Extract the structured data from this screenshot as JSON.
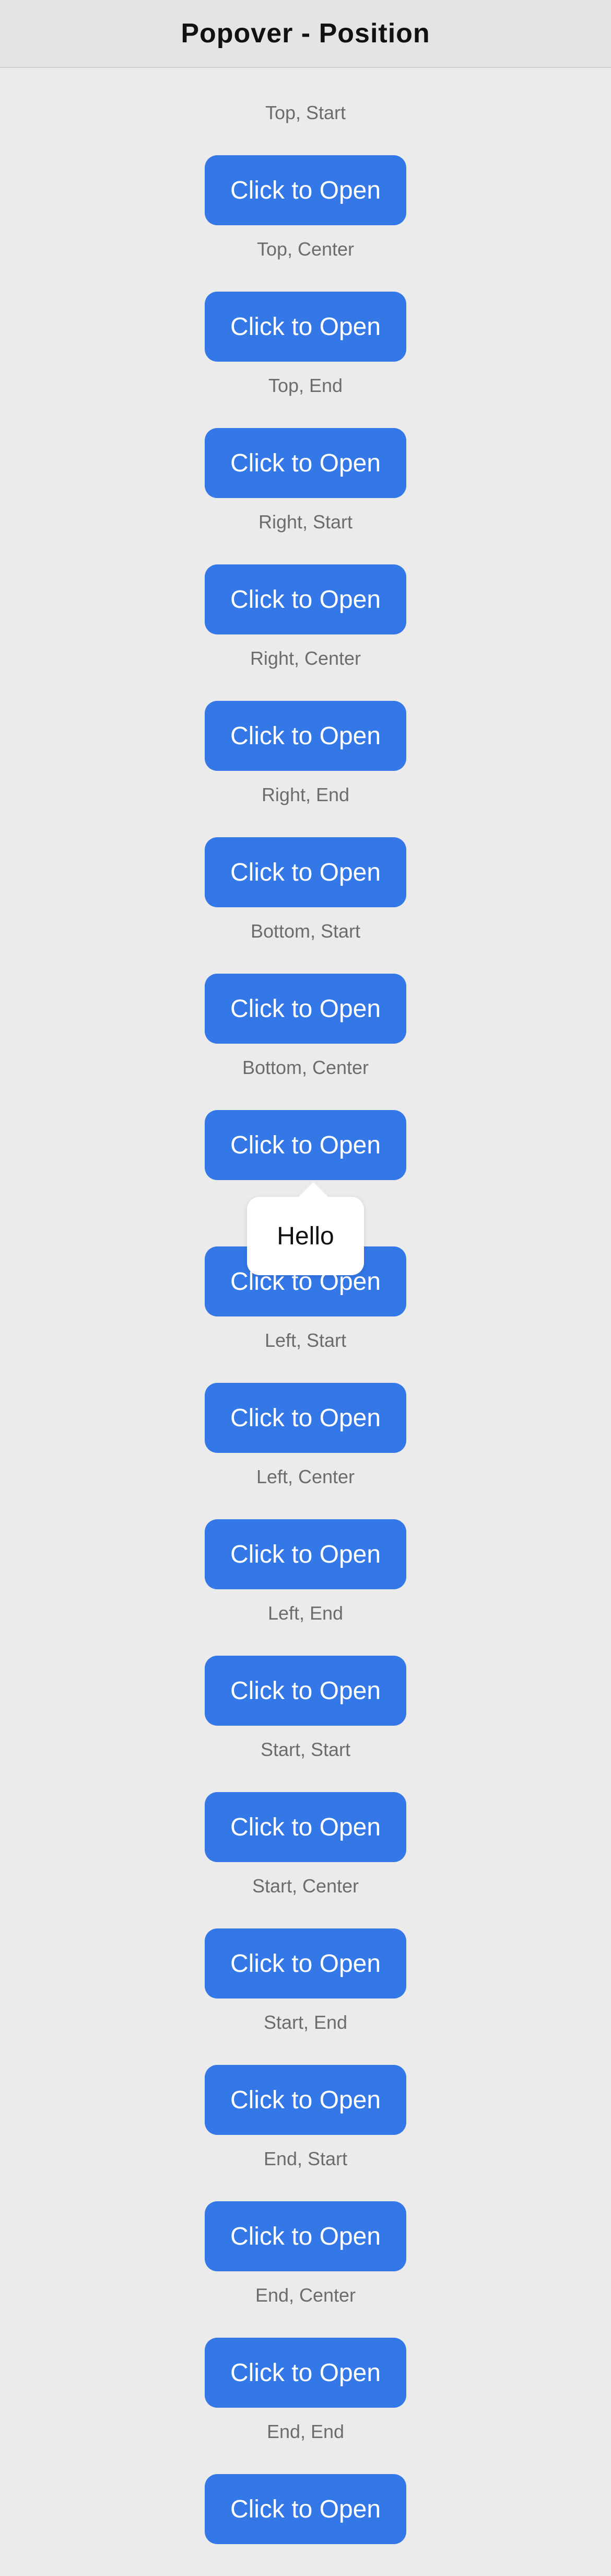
{
  "header": {
    "title": "Popover - Position"
  },
  "button_label": "Click to Open",
  "items": [
    {
      "label": "Top, Start"
    },
    {
      "label": "Top, Center"
    },
    {
      "label": "Top, End"
    },
    {
      "label": "Right, Start"
    },
    {
      "label": "Right, Center"
    },
    {
      "label": "Right, End"
    },
    {
      "label": "Bottom, Start"
    },
    {
      "label": "Bottom, Center"
    },
    {
      "label": ""
    },
    {
      "label": "Left, Start"
    },
    {
      "label": "Left, Center"
    },
    {
      "label": "Left, End"
    },
    {
      "label": "Start, Start"
    },
    {
      "label": "Start, Center"
    },
    {
      "label": "Start, End"
    },
    {
      "label": "End, Start"
    },
    {
      "label": "End, Center"
    },
    {
      "label": "End, End"
    }
  ],
  "popover": {
    "text": "Hello"
  },
  "colors": {
    "background": "#ebebeb",
    "header_background": "#e4e4e4",
    "button": "#3478e8",
    "button_text": "#ffffff",
    "label_text": "#6c6c6c"
  }
}
